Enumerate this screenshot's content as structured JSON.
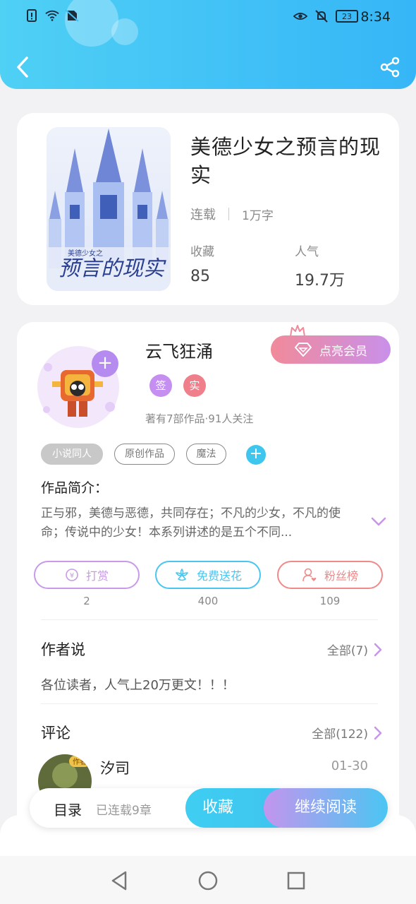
{
  "status_bar": {
    "time": "8:34",
    "battery": "23",
    "icons": [
      "sim-alert-icon",
      "wifi-icon",
      "no-sim-icon",
      "eye-icon",
      "mute-icon",
      "battery-icon"
    ]
  },
  "header": {
    "back_icon": "chevron-left-icon",
    "share_icon": "share-icon",
    "color": "#3ec2f5"
  },
  "book": {
    "title": "美德少女之预言的现实",
    "status": "连载",
    "word_count": "1万字",
    "favorites_label": "收藏",
    "favorites_value": "85",
    "popularity_label": "人气",
    "popularity_value": "19.7万",
    "cover_text": "预言的现实",
    "cover_small_text": "美德少女之"
  },
  "author": {
    "name": "云飞狂涌",
    "vip_button": "点亮会员",
    "badges": [
      {
        "label": "签",
        "color": "#c48ff0"
      },
      {
        "label": "实",
        "color": "#f07f8c"
      }
    ],
    "stats": "著有7部作品·91人关注",
    "tags": [
      "小说同人",
      "原创作品",
      "魔法"
    ],
    "intro_label": "作品简介：",
    "intro_text": "正与邪，美德与恶德，共同存在；不凡的少女，不凡的使命；传说中的少女！本系列讲述的是五个不同..."
  },
  "actions": [
    {
      "label": "打赏",
      "count": "2",
      "color": "#c89ae8"
    },
    {
      "label": "免费送花",
      "count": "400",
      "color": "#48c6ef"
    },
    {
      "label": "粉丝榜",
      "count": "109",
      "color": "#ef8a8a"
    }
  ],
  "author_said": {
    "title": "作者说",
    "more": "全部(7)",
    "text": "各位读者，人气上20万更文！！！"
  },
  "comments": {
    "title": "评论",
    "more": "全部(122)",
    "items": [
      {
        "user": "汐司",
        "date": "01-30",
        "avatar_badge": "作者"
      }
    ]
  },
  "bottom_bar": {
    "toc": "目录",
    "chapters": "已连载9章",
    "collect": "收藏",
    "read": "继续阅读"
  },
  "navbar": {
    "icons": [
      "back-triangle-icon",
      "home-circle-icon",
      "recent-square-icon"
    ]
  }
}
